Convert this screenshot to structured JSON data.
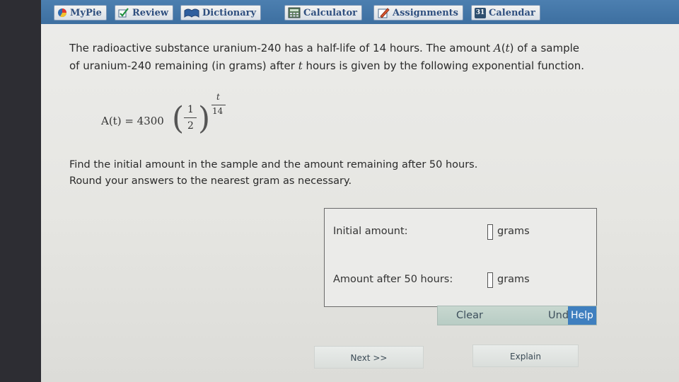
{
  "tabs": [
    {
      "label": "MyPie",
      "icon": "pie-icon"
    },
    {
      "label": "Review",
      "icon": "checkmark-icon"
    },
    {
      "label": "Dictionary",
      "icon": "book-icon"
    },
    {
      "label": "Calculator",
      "icon": "calculator-icon"
    },
    {
      "label": "Assignments",
      "icon": "pencil-icon"
    },
    {
      "label": "Calendar",
      "icon": "calendar-icon"
    }
  ],
  "calendar_day": "31",
  "problem": {
    "line1_a": "The radioactive substance uranium-240 has a half-life of 14 hours. The amount ",
    "func": "A",
    "var": "t",
    "line1_b": " of a sample",
    "line2_a": "of uranium-240 remaining (in grams) after ",
    "line2_b": " hours is given by the following exponential function."
  },
  "formula": {
    "lhs": "A(t) = 4300",
    "base_num": "1",
    "base_den": "2",
    "exp_num": "t",
    "exp_den": "14"
  },
  "task": {
    "line1": "Find the initial amount in the sample and the amount remaining after 50 hours.",
    "line2": "Round your answers to the nearest gram as necessary."
  },
  "answers": {
    "initial_label": "Initial amount:",
    "initial_value": "",
    "initial_unit": "grams",
    "after_label": "Amount after 50 hours:",
    "after_value": "",
    "after_unit": "grams"
  },
  "buttons": {
    "clear": "Clear",
    "undo": "Undo",
    "help": "Help",
    "next": "Next >>",
    "explain": "Explain"
  },
  "colors": {
    "tabbar": "#3d6fa0",
    "tab_text": "#2f4f7f",
    "help": "#3f7fbf"
  }
}
